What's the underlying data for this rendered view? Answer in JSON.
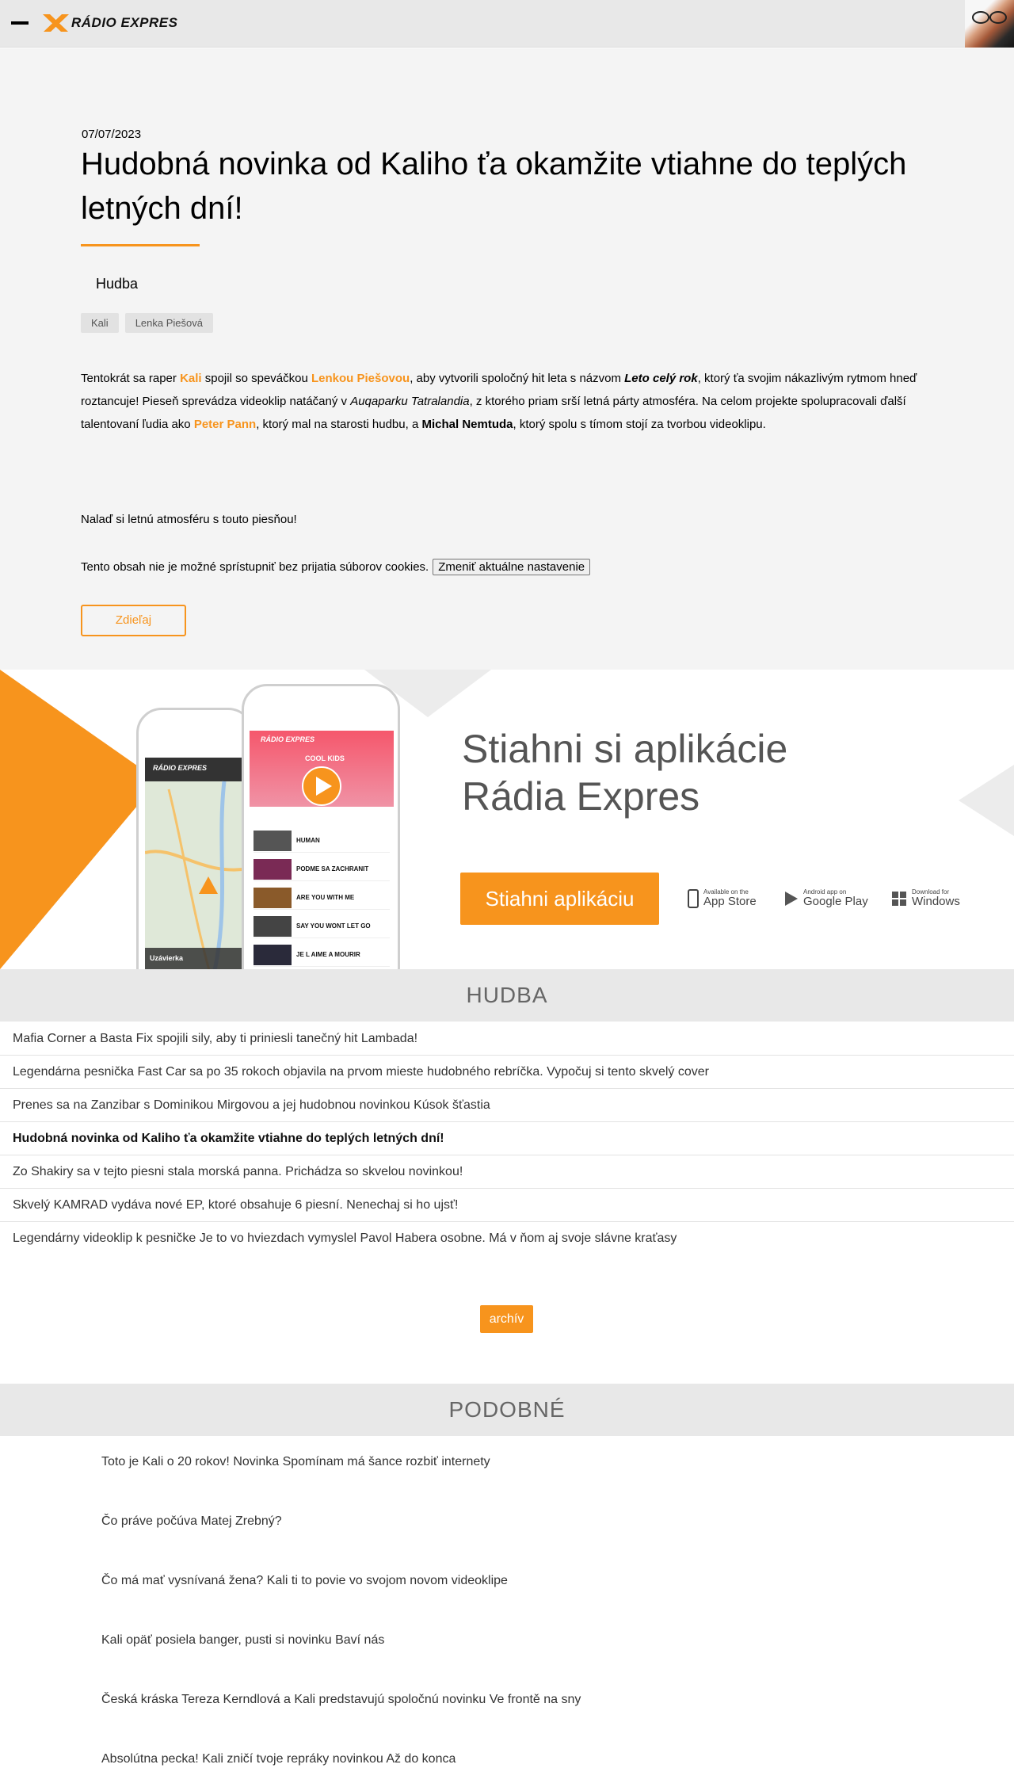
{
  "header": {
    "logo_text": "RÁDIO EXPRES",
    "menu_icon": "hamburger-icon"
  },
  "article": {
    "date": "07/07/2023",
    "title": "Hudobná novinka od Kaliho ťa okamžite vtiahne do teplých letných dní!",
    "category": "Hudba",
    "tags": [
      "Kali",
      "Lenka Piešová"
    ],
    "body": {
      "s1": "Tentokrát sa raper ",
      "kali": "Kali",
      "s2": " spojil so speváčkou ",
      "lenka": "Lenkou Piešovou",
      "s3": ", aby vytvorili spoločný hit leta s názvom ",
      "song": "Leto celý rok",
      "s4": ", ktorý ťa svojim nákazlivým rytmom hneď roztancuje! Pieseň sprevádza videoklip natáčaný v ",
      "park": "Auqaparku Tatralandia",
      "s5": ", z ktorého priam srší letná párty atmosféra. Na celom projekte spolupracovali ďalší talentovaní ľudia ako ",
      "peter": "Peter Pann",
      "s6": ", ktorý mal na starosti hudbu, a ",
      "michal": "Michal Nemtuda",
      "s7": ", ktorý spolu s tímom stojí za tvorbou videoklipu."
    },
    "p2": "Nalaď si letnú atmosféru s touto piesňou!",
    "cookie_text": "Tento obsah nie je možné sprístupniť bez prijatia súborov cookies.",
    "cookie_button": "Zmeniť aktuálne nastavenie",
    "share_button": "Zdieľaj"
  },
  "banner": {
    "heading_line1": "Stiahni si aplikácie",
    "heading_line2": "Rádia Expres",
    "download_button": "Stiahni aplikáciu",
    "stores": [
      {
        "small": "Available on the",
        "big": "App Store",
        "icon": "phone-icon"
      },
      {
        "small": "Android app on",
        "big": "Google Play",
        "icon": "play-icon"
      },
      {
        "small": "Download for",
        "big": "Windows",
        "icon": "windows-icon"
      }
    ],
    "phone_front": {
      "logo": "RÁDIO EXPRES",
      "now_playing": "COOL KIDS",
      "tracks": [
        "HUMAN",
        "PODME SA ZACHRANIT",
        "ARE YOU WITH ME",
        "SAY YOU WONT LET GO",
        "JE L AIME A MOURIR"
      ]
    },
    "phone_back": {
      "logo": "RÁDIO EXPRES",
      "label": "Uzávierka"
    }
  },
  "hudba": {
    "heading": "HUDBA",
    "items": [
      "Mafia Corner a Basta Fix spojili sily, aby ti priniesli tanečný hit Lambada!",
      "Legendárna pesnička Fast Car sa po 35 rokoch objavila na prvom mieste hudobného rebríčka. Vypočuj si tento skvelý cover",
      "Prenes sa na Zanzibar s Dominikou Mirgovou a jej hudobnou novinkou Kúsok šťastia",
      "Hudobná novinka od Kaliho ťa okamžite vtiahne do teplých letných dní!",
      "Zo Shakiry sa v tejto piesni stala morská panna. Prichádza so skvelou novinkou!",
      "Skvelý KAMRAD vydáva nové EP, ktoré obsahuje 6 piesní. Nenechaj si ho ujsť!",
      "Legendárny videoklip k pesničke Je to vo hviezdach vymyslel Pavol Habera osobne. Má v ňom aj svoje slávne kraťasy"
    ],
    "archive_button": "archív"
  },
  "podobne": {
    "heading": "PODOBNÉ",
    "items": [
      "Toto je Kali o 20 rokov! Novinka Spomínam má šance rozbiť internety",
      "Čo práve počúva Matej Zrebný?",
      "Čo má mať vysnívaná žena? Kali ti to povie vo svojom novom videoklipe",
      "Kali opäť posiela banger, pusti si novinku Baví nás",
      "Česká kráska Tereza Kerndlová a Kali predstavujú spoločnú novinku Ve frontě na sny",
      "Absolútna pecka! Kali zničí tvoje repráky novinkou Až do konca"
    ]
  },
  "colors": {
    "accent": "#f7941d",
    "section_bg": "#e8e8e8",
    "article_bg": "#f4f4f4"
  }
}
